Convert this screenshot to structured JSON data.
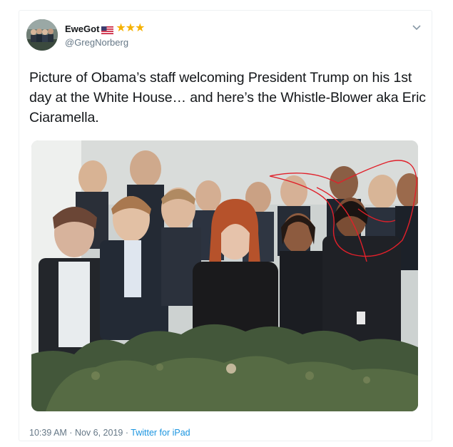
{
  "author": {
    "display_name": "EweGot",
    "flag_icon": "us-flag-icon",
    "stars": "★★★",
    "handle": "@GregNorberg",
    "avatar_icon": "avatar-image"
  },
  "tweet": {
    "text": "Picture of Obama’s staff welcoming President Trump on his 1st day at the White House… and here’s the Whistle-Blower aka Eric Ciaramella.",
    "menu_icon": "chevron-down-icon",
    "photo": "group-photo"
  },
  "meta": {
    "time": "10:39 AM",
    "separator1": " · ",
    "date": "Nov 6, 2019",
    "separator2": " · ",
    "source": "Twitter for iPad"
  },
  "colors": {
    "link": "#1b95e0",
    "secondary_text": "#657786",
    "star": "#f5b100"
  }
}
